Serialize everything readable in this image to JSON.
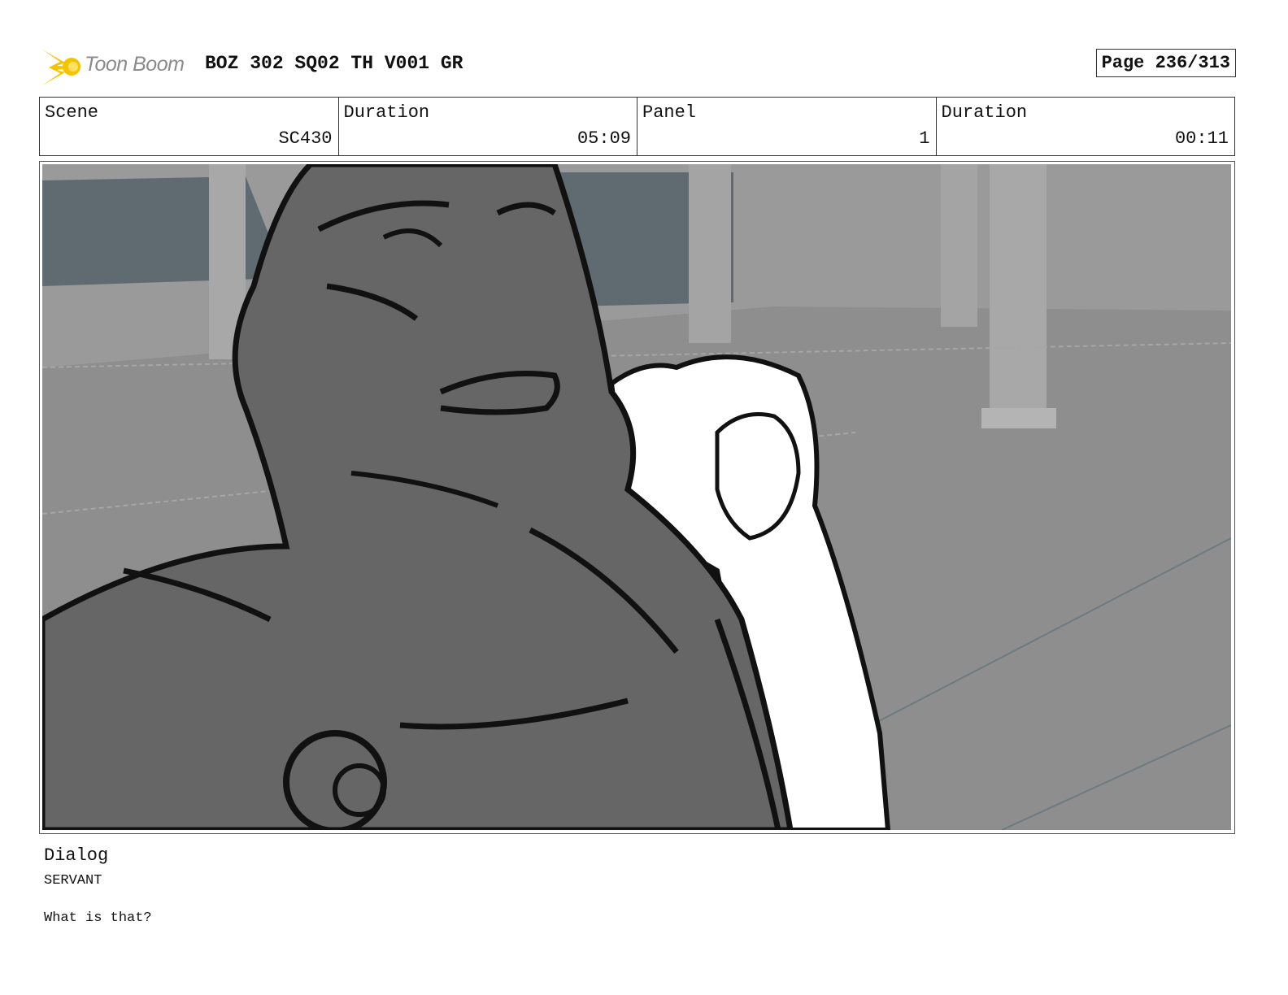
{
  "header": {
    "logo_text": "Toon Boom",
    "logo_icon": "toon-boom-starburst-icon",
    "title": "BOZ 302 SQ02 TH V001 GR",
    "page": "Page 236/313"
  },
  "info": {
    "scene_label": "Scene",
    "scene_value": "SC430",
    "duration_label": "Duration",
    "duration_value": "05:09",
    "panel_label": "Panel",
    "panel_value": "1",
    "panel_duration_label": "Duration",
    "panel_duration_value": "00:11"
  },
  "panel": {
    "image_icon": "storyboard-sketch-image"
  },
  "dialog": {
    "label": "Dialog",
    "speaker": "SERVANT",
    "line": "What is that?"
  },
  "colors": {
    "logo_yellow": "#f5c400",
    "logo_gray": "#8a8a8a",
    "background_gray": "#8c8c8c",
    "character_gray": "#666666"
  }
}
